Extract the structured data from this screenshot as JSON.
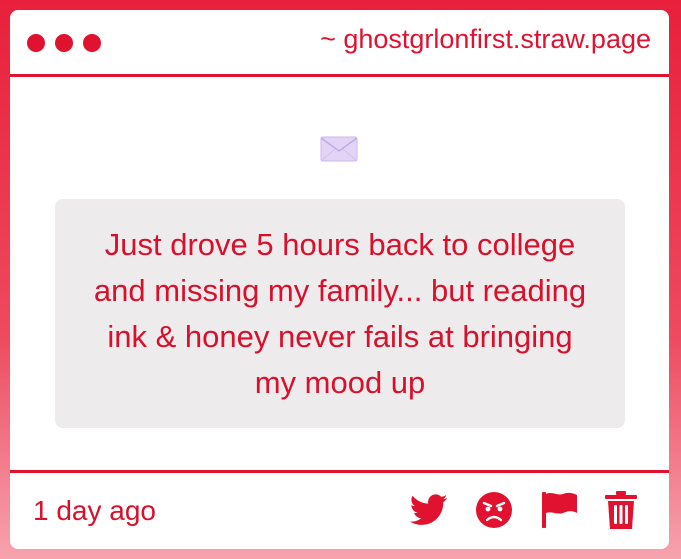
{
  "titlebar": {
    "site_url": "~ ghostgrlonfirst.straw.page"
  },
  "message": {
    "text": "Just drove 5 hours back to college and missing my family... but reading ink & honey never fails at bringing my mood up"
  },
  "footer": {
    "timestamp": "1 day ago",
    "icons": [
      "twitter-icon",
      "angry-face-icon",
      "flag-icon",
      "trash-icon"
    ]
  },
  "colors": {
    "accent": "#e0122f",
    "card_bg": "#eeebed",
    "envelope": "#d9c8f0"
  }
}
